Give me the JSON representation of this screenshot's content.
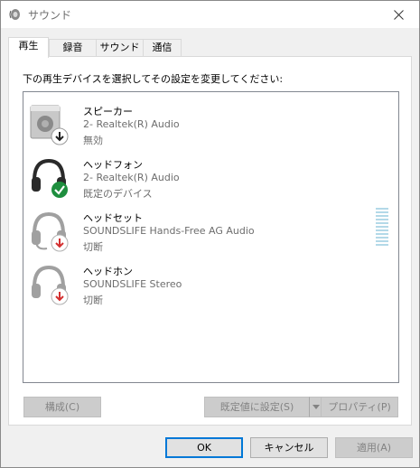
{
  "window": {
    "title": "サウンド"
  },
  "tabs": [
    {
      "label": "再生",
      "active": true
    },
    {
      "label": "録音",
      "active": false
    },
    {
      "label": "サウンド",
      "active": false
    },
    {
      "label": "通信",
      "active": false
    }
  ],
  "playback": {
    "instruction": "下の再生デバイスを選択してその設定を変更してください:",
    "devices": [
      {
        "name": "スピーカー",
        "description": "2- Realtek(R) Audio",
        "status": "無効",
        "icon": "speaker-icon",
        "badge": "disabled-arrow-icon"
      },
      {
        "name": "ヘッドフォン",
        "description": "2- Realtek(R) Audio",
        "status": "既定のデバイス",
        "icon": "headphones-icon",
        "badge": "default-check-icon"
      },
      {
        "name": "ヘッドセット",
        "description": "SOUNDSLIFE Hands-Free AG Audio",
        "status": "切断",
        "icon": "headset-icon",
        "badge": "disconnected-arrow-icon"
      },
      {
        "name": "ヘッドホン",
        "description": "SOUNDSLIFE Stereo",
        "status": "切断",
        "icon": "headphones-icon",
        "badge": "disconnected-arrow-icon"
      }
    ],
    "configure_label": "構成(C)",
    "set_default_label": "既定値に設定(S)",
    "properties_label": "プロパティ(P)"
  },
  "footer": {
    "ok_label": "OK",
    "cancel_label": "キャンセル",
    "apply_label": "適用(A)"
  },
  "colors": {
    "accent": "#0078d7",
    "default_check": "#1e8e3e",
    "disconnected_arrow": "#d32f2f",
    "level_meter": "#b3d9e8"
  }
}
